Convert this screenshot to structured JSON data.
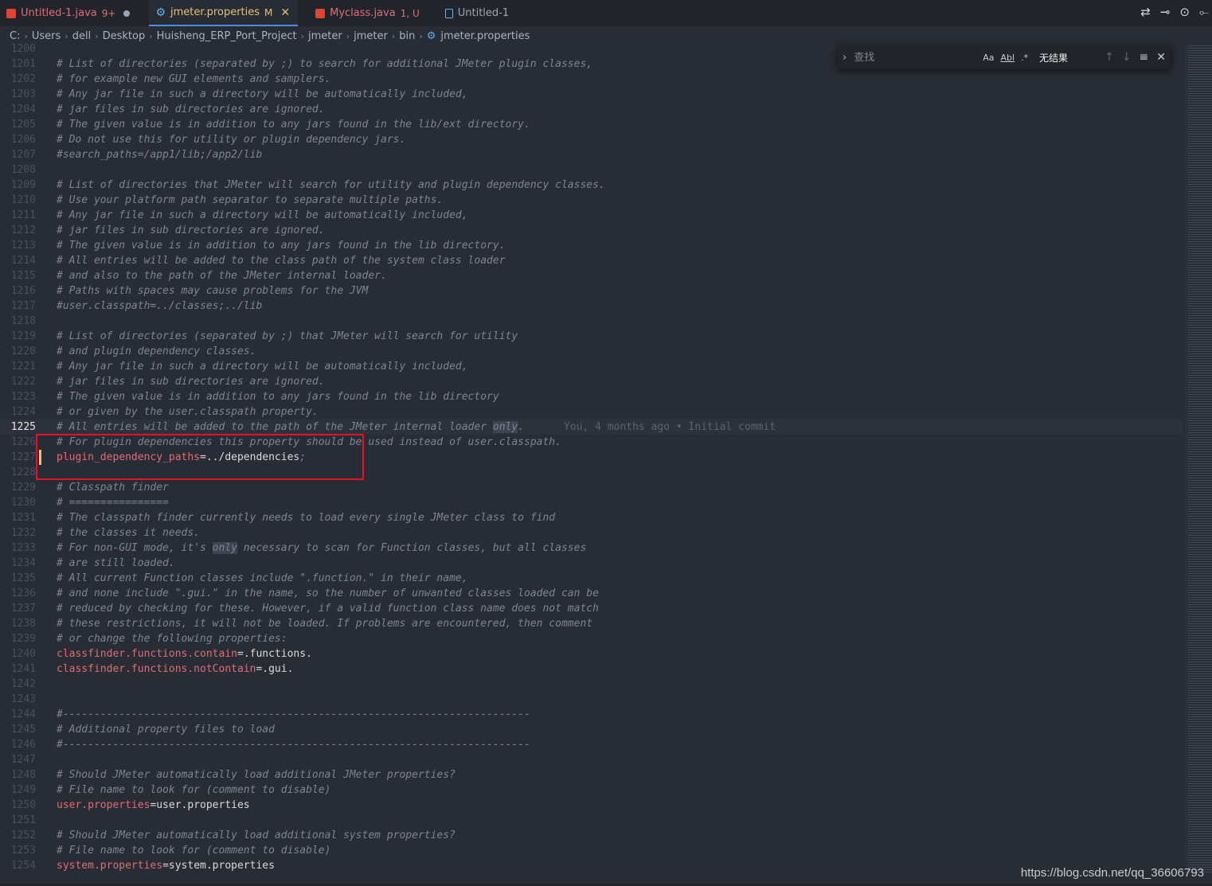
{
  "tabs": [
    {
      "name": "Untitled-1.java",
      "badge": "9+",
      "state": "dot",
      "icon": "java-icon"
    },
    {
      "name": "jmeter.properties",
      "badge": "M",
      "state": "close",
      "icon": "gear-icon",
      "active": true
    },
    {
      "name": "Myclass.java",
      "badge": "1, U",
      "state": "",
      "icon": "java-icon"
    },
    {
      "name": "Untitled-1",
      "badge": "",
      "state": "",
      "icon": "file-icon"
    }
  ],
  "breadcrumb": [
    "C:",
    "Users",
    "dell",
    "Desktop",
    "Huisheng_ERP_Port_Project",
    "jmeter",
    "jmeter",
    "bin",
    "jmeter.properties"
  ],
  "find": {
    "placeholder": "查找",
    "opt_case": "Aa",
    "opt_word": "Abl",
    "opt_regex": ".*",
    "result": "无结果",
    "prev": "↑",
    "next": "↓",
    "menu": "≡",
    "close": "✕"
  },
  "lines": [
    {
      "n": "1200",
      "t": ""
    },
    {
      "n": "1201",
      "t": "# List of directories (separated by ;) to search for additional JMeter plugin classes,"
    },
    {
      "n": "1202",
      "t": "# for example new GUI elements and samplers."
    },
    {
      "n": "1203",
      "t": "# Any jar file in such a directory will be automatically included,"
    },
    {
      "n": "1204",
      "t": "# jar files in sub directories are ignored."
    },
    {
      "n": "1205",
      "t": "# The given value is in addition to any jars found in the lib/ext directory."
    },
    {
      "n": "1206",
      "t": "# Do not use this for utility or plugin dependency jars."
    },
    {
      "n": "1207",
      "t": "#search_paths=/app1/lib;/app2/lib"
    },
    {
      "n": "1208",
      "t": ""
    },
    {
      "n": "1209",
      "t": "# List of directories that JMeter will search for utility and plugin dependency classes."
    },
    {
      "n": "1210",
      "t": "# Use your platform path separator to separate multiple paths."
    },
    {
      "n": "1211",
      "t": "# Any jar file in such a directory will be automatically included,"
    },
    {
      "n": "1212",
      "t": "# jar files in sub directories are ignored."
    },
    {
      "n": "1213",
      "t": "# The given value is in addition to any jars found in the lib directory."
    },
    {
      "n": "1214",
      "t": "# All entries will be added to the class path of the system class loader"
    },
    {
      "n": "1215",
      "t": "# and also to the path of the JMeter internal loader."
    },
    {
      "n": "1216",
      "t": "# Paths with spaces may cause problems for the JVM"
    },
    {
      "n": "1217",
      "t": "#user.classpath=../classes;../lib"
    },
    {
      "n": "1218",
      "t": ""
    },
    {
      "n": "1219",
      "t": "# List of directories (separated by ;) that JMeter will search for utility"
    },
    {
      "n": "1220",
      "t": "# and plugin dependency classes."
    },
    {
      "n": "1221",
      "t": "# Any jar file in such a directory will be automatically included,"
    },
    {
      "n": "1222",
      "t": "# jar files in sub directories are ignored."
    },
    {
      "n": "1223",
      "t": "# The given value is in addition to any jars found in the lib directory"
    },
    {
      "n": "1224",
      "t": "# or given by the user.classpath property."
    },
    {
      "n": "1225",
      "t": "# All entries will be added to the path of the JMeter internal loader ",
      "hl": "only",
      "tail": ".",
      "blame": "You, 4 months ago • Initial commit",
      "current": true
    },
    {
      "n": "1226",
      "t": "# For plugin dependencies this property should be used instead of user.classpath."
    },
    {
      "n": "1227",
      "k": "plugin_dependency_paths",
      "v": "../dependencies",
      "semi": ";",
      "mark": true
    },
    {
      "n": "1228",
      "t": ""
    },
    {
      "n": "1229",
      "t": "# Classpath finder"
    },
    {
      "n": "1230",
      "t": "# ================"
    },
    {
      "n": "1231",
      "t": "# The classpath finder currently needs to load every single JMeter class to find"
    },
    {
      "n": "1232",
      "t": "# the classes it needs."
    },
    {
      "n": "1233",
      "t": "# For non-GUI mode, it's ",
      "hl": "only",
      "tail": " necessary to scan for Function classes, but all classes"
    },
    {
      "n": "1234",
      "t": "# are still loaded."
    },
    {
      "n": "1235",
      "t": "# All current Function classes include \".function.\" in their name,"
    },
    {
      "n": "1236",
      "t": "# and none include \".gui.\" in the name, so the number of unwanted classes loaded can be"
    },
    {
      "n": "1237",
      "t": "# reduced by checking for these. However, if a valid function class name does not match"
    },
    {
      "n": "1238",
      "t": "# these restrictions, it will not be loaded. If problems are encountered, then comment"
    },
    {
      "n": "1239",
      "t": "# or change the following properties:"
    },
    {
      "n": "1240",
      "k": "classfinder.functions.contain",
      "v": ".functions."
    },
    {
      "n": "1241",
      "k": "classfinder.functions.notContain",
      "v": ".gui."
    },
    {
      "n": "1242",
      "t": ""
    },
    {
      "n": "1243",
      "t": ""
    },
    {
      "n": "1244",
      "t": "#---------------------------------------------------------------------------"
    },
    {
      "n": "1245",
      "t": "# Additional property files to load"
    },
    {
      "n": "1246",
      "t": "#---------------------------------------------------------------------------"
    },
    {
      "n": "1247",
      "t": ""
    },
    {
      "n": "1248",
      "t": "# Should JMeter automatically load additional JMeter properties?"
    },
    {
      "n": "1249",
      "t": "# File name to look for (comment to disable)"
    },
    {
      "n": "1250",
      "k": "user.properties",
      "v": "user.properties"
    },
    {
      "n": "1251",
      "t": ""
    },
    {
      "n": "1252",
      "t": "# Should JMeter automatically load additional system properties?"
    },
    {
      "n": "1253",
      "t": "# File name to look for (comment to disable)"
    },
    {
      "n": "1254",
      "k": "system.properties",
      "v": "system.properties"
    }
  ],
  "watermark": "https://blog.csdn.net/qq_36606793",
  "colors": {
    "comment": "#7f848e",
    "key": "#e06c75",
    "value": "#d7dae0",
    "annotation": "#e81123",
    "active_tab_border": "#528bff"
  }
}
